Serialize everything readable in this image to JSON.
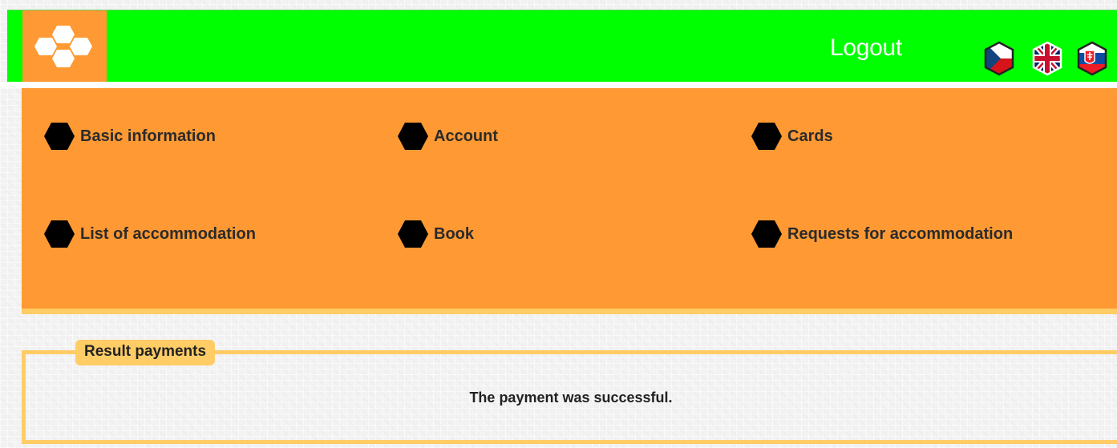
{
  "header": {
    "logo_icon": "hexagon-cluster-logo",
    "logout_label": "Logout",
    "languages": [
      {
        "code": "cs",
        "icon": "czech-flag-icon"
      },
      {
        "code": "en",
        "icon": "uk-flag-icon"
      },
      {
        "code": "sk",
        "icon": "slovak-flag-icon"
      }
    ]
  },
  "nav": {
    "items": [
      {
        "label": "Basic information",
        "icon": "hexagon-bullet-icon"
      },
      {
        "label": "Account",
        "icon": "hexagon-bullet-icon"
      },
      {
        "label": "Cards",
        "icon": "hexagon-bullet-icon"
      },
      {
        "label": "List of accommodation",
        "icon": "hexagon-bullet-icon"
      },
      {
        "label": "Book",
        "icon": "hexagon-bullet-icon"
      },
      {
        "label": "Requests for accommodation",
        "icon": "hexagon-bullet-icon"
      }
    ]
  },
  "result": {
    "legend": "Result payments",
    "message": "The payment was successful."
  },
  "colors": {
    "header_green": "#00ff00",
    "accent_orange": "#ff9933",
    "light_orange": "#ffcc66",
    "text_dark": "#2b2b2b"
  }
}
